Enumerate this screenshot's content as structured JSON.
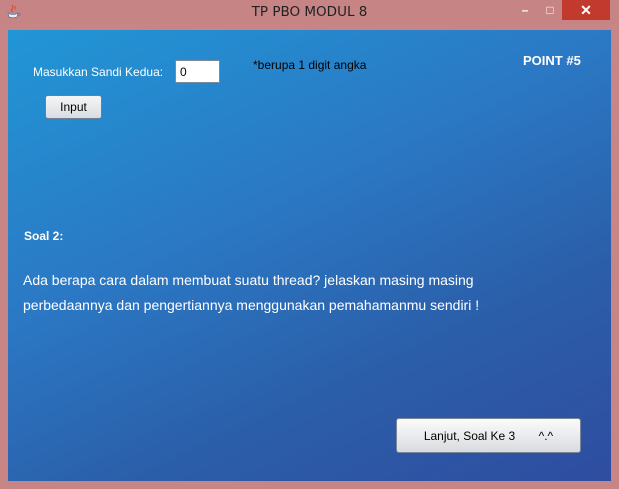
{
  "window": {
    "title": "TP PBO MODUL 8"
  },
  "form": {
    "label": "Masukkan Sandi Kedua:",
    "input_value": "0",
    "hint": "*berupa 1 digit angka",
    "point": "POINT #5",
    "input_button": "Input"
  },
  "question": {
    "label": "Soal 2:",
    "line1": "Ada berapa cara dalam membuat suatu thread? jelaskan masing masing",
    "line2": "perbedaannya dan pengertiannya menggunakan pemahamanmu sendiri !"
  },
  "next_button": {
    "label": "Lanjut, Soal Ke 3       ^.^"
  }
}
